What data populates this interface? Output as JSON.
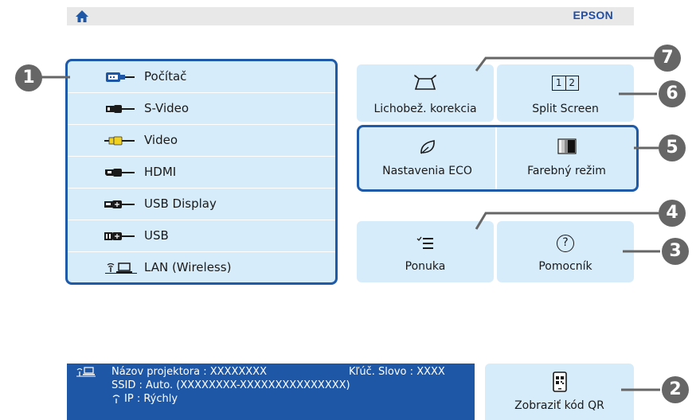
{
  "header": {
    "brand": "EPSON",
    "home_icon": "home-icon"
  },
  "sources": [
    {
      "label": "Počítač",
      "icon": "computer-port-icon"
    },
    {
      "label": "S-Video",
      "icon": "svideo-port-icon"
    },
    {
      "label": "Video",
      "icon": "video-port-icon"
    },
    {
      "label": "HDMI",
      "icon": "hdmi-port-icon"
    },
    {
      "label": "USB Display",
      "icon": "usb-display-port-icon"
    },
    {
      "label": "USB",
      "icon": "usb-port-icon"
    },
    {
      "label": "LAN (Wireless)",
      "icon": "wireless-lan-icon"
    }
  ],
  "tiles": {
    "keystone": {
      "label": "Lichobež. korekcia",
      "icon": "keystone-icon"
    },
    "split": {
      "label": "Split Screen",
      "icon": "split-screen-icon",
      "icon_text": [
        "1",
        "2"
      ]
    },
    "eco": {
      "label": "Nastavenia ECO",
      "icon": "leaf-icon"
    },
    "color": {
      "label": "Farebný režim",
      "icon": "color-mode-icon"
    },
    "menu": {
      "label": "Ponuka",
      "icon": "menu-list-icon"
    },
    "help": {
      "label": "Pomocník",
      "icon": "help-icon",
      "icon_text": "?"
    },
    "qr": {
      "label": "Zobraziť kód QR",
      "icon": "qr-code-icon"
    }
  },
  "network": {
    "projector_name_label": "Názov projektora",
    "projector_name_value": "XXXXXXXX",
    "keyword_label": "Kľúč. Slovo",
    "keyword_value": "XXXX",
    "ssid_label": "SSID",
    "ssid_value": "Auto. (XXXXXXXX-XXXXXXXXXXXXXXX)",
    "ip_label": "IP",
    "ip_value": "Rýchly",
    "separator": ":"
  },
  "callouts": [
    "1",
    "2",
    "3",
    "4",
    "5",
    "6",
    "7"
  ],
  "colors": {
    "accent": "#1e5aa8",
    "tile_bg": "#d7ecfa",
    "brand": "#1f4ea8",
    "callout": "#666666",
    "info_bg": "#1f57a7"
  }
}
